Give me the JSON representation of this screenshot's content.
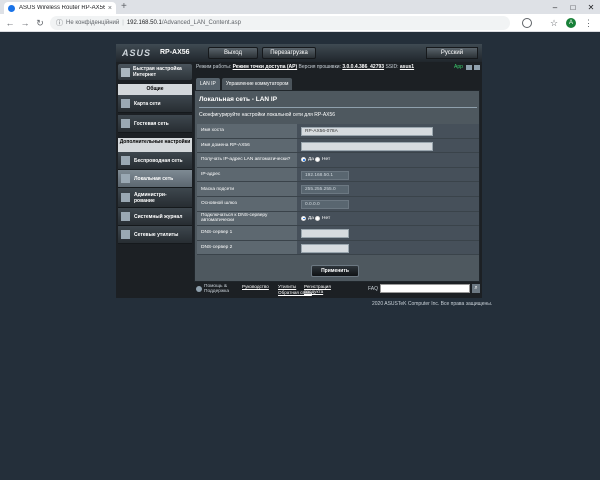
{
  "browser": {
    "tab_title": "ASUS Wireless Router RP-AX56",
    "tab_close": "×",
    "new_tab": "+",
    "window_controls": [
      "–",
      "□",
      "✕"
    ],
    "nav": {
      "back": "←",
      "forward": "→",
      "reload": "↻"
    },
    "security_label": "Не конфіденційний",
    "url_host": "192.168.50.1",
    "url_path": "/Advanced_LAN_Content.asp",
    "star": "☆",
    "avatar_letter": "A",
    "menu": "⋮"
  },
  "router": {
    "logo": "ASUS",
    "model": "RP-AX56",
    "logout_label": "Выход",
    "reboot_label": "Перезагрузка",
    "language": "Русский",
    "status": {
      "mode_label": "Режим работы:",
      "mode_value": "Режим точки доступа (AP)",
      "firmware_label": "Версия прошивки:",
      "firmware_value": "3.0.0.4.386_42793",
      "ssid_label": "SSID:",
      "ssid_value": "asus1",
      "app_label": "App"
    },
    "sidebar": {
      "quick_setup": "Быстрая настройка Интернет",
      "general_title": "Общие",
      "general_items": [
        "Карта сети",
        "Гостевая сеть"
      ],
      "advanced_title": "Дополнительные настройки",
      "advanced_items": [
        "Беспроводная сеть",
        "Локальная сеть",
        "Администри-рование",
        "Системный журнал",
        "Сетевые утилиты"
      ]
    },
    "tabs": [
      "LAN IP",
      "Управление коммутатором"
    ],
    "page_title": "Локальная сеть - LAN IP",
    "description": "Сконфигурируйте настройки локальной сети для RP-AX56",
    "fields": {
      "host_name": {
        "label": "Имя хоста",
        "value": "RP-AX56-078A"
      },
      "domain": {
        "label": "Имя домена RP-AX56",
        "value": ""
      },
      "auto_ip": {
        "label": "Получать IP-адрес LAN автоматически?",
        "yes": "Да",
        "no": "Нет",
        "selected": "yes"
      },
      "ip": {
        "label": "IP-адрес",
        "value": "192.168.50.1"
      },
      "mask": {
        "label": "Маска подсети",
        "value": "255.255.255.0"
      },
      "gateway": {
        "label": "Основной шлюз",
        "value": "0.0.0.0"
      },
      "auto_dns": {
        "label": "Подключаться к DNS-серверу автоматически",
        "yes": "Да",
        "no": "Нет",
        "selected": "yes"
      },
      "dns1": {
        "label": "DNS-сервер 1",
        "value": ""
      },
      "dns2": {
        "label": "DNS-сервер 2",
        "value": ""
      }
    },
    "apply_label": "Применить",
    "footer": {
      "help": "Помощь & Поддержка",
      "link1": "Руководство",
      "link2": "Утилиты",
      "link3": "Регистрация продукта",
      "link4": "Обратная связь",
      "faq": "FAQ",
      "search_go": "⌕"
    },
    "copyright": "2020 ASUSTeK Computer Inc. Все права защищены."
  }
}
